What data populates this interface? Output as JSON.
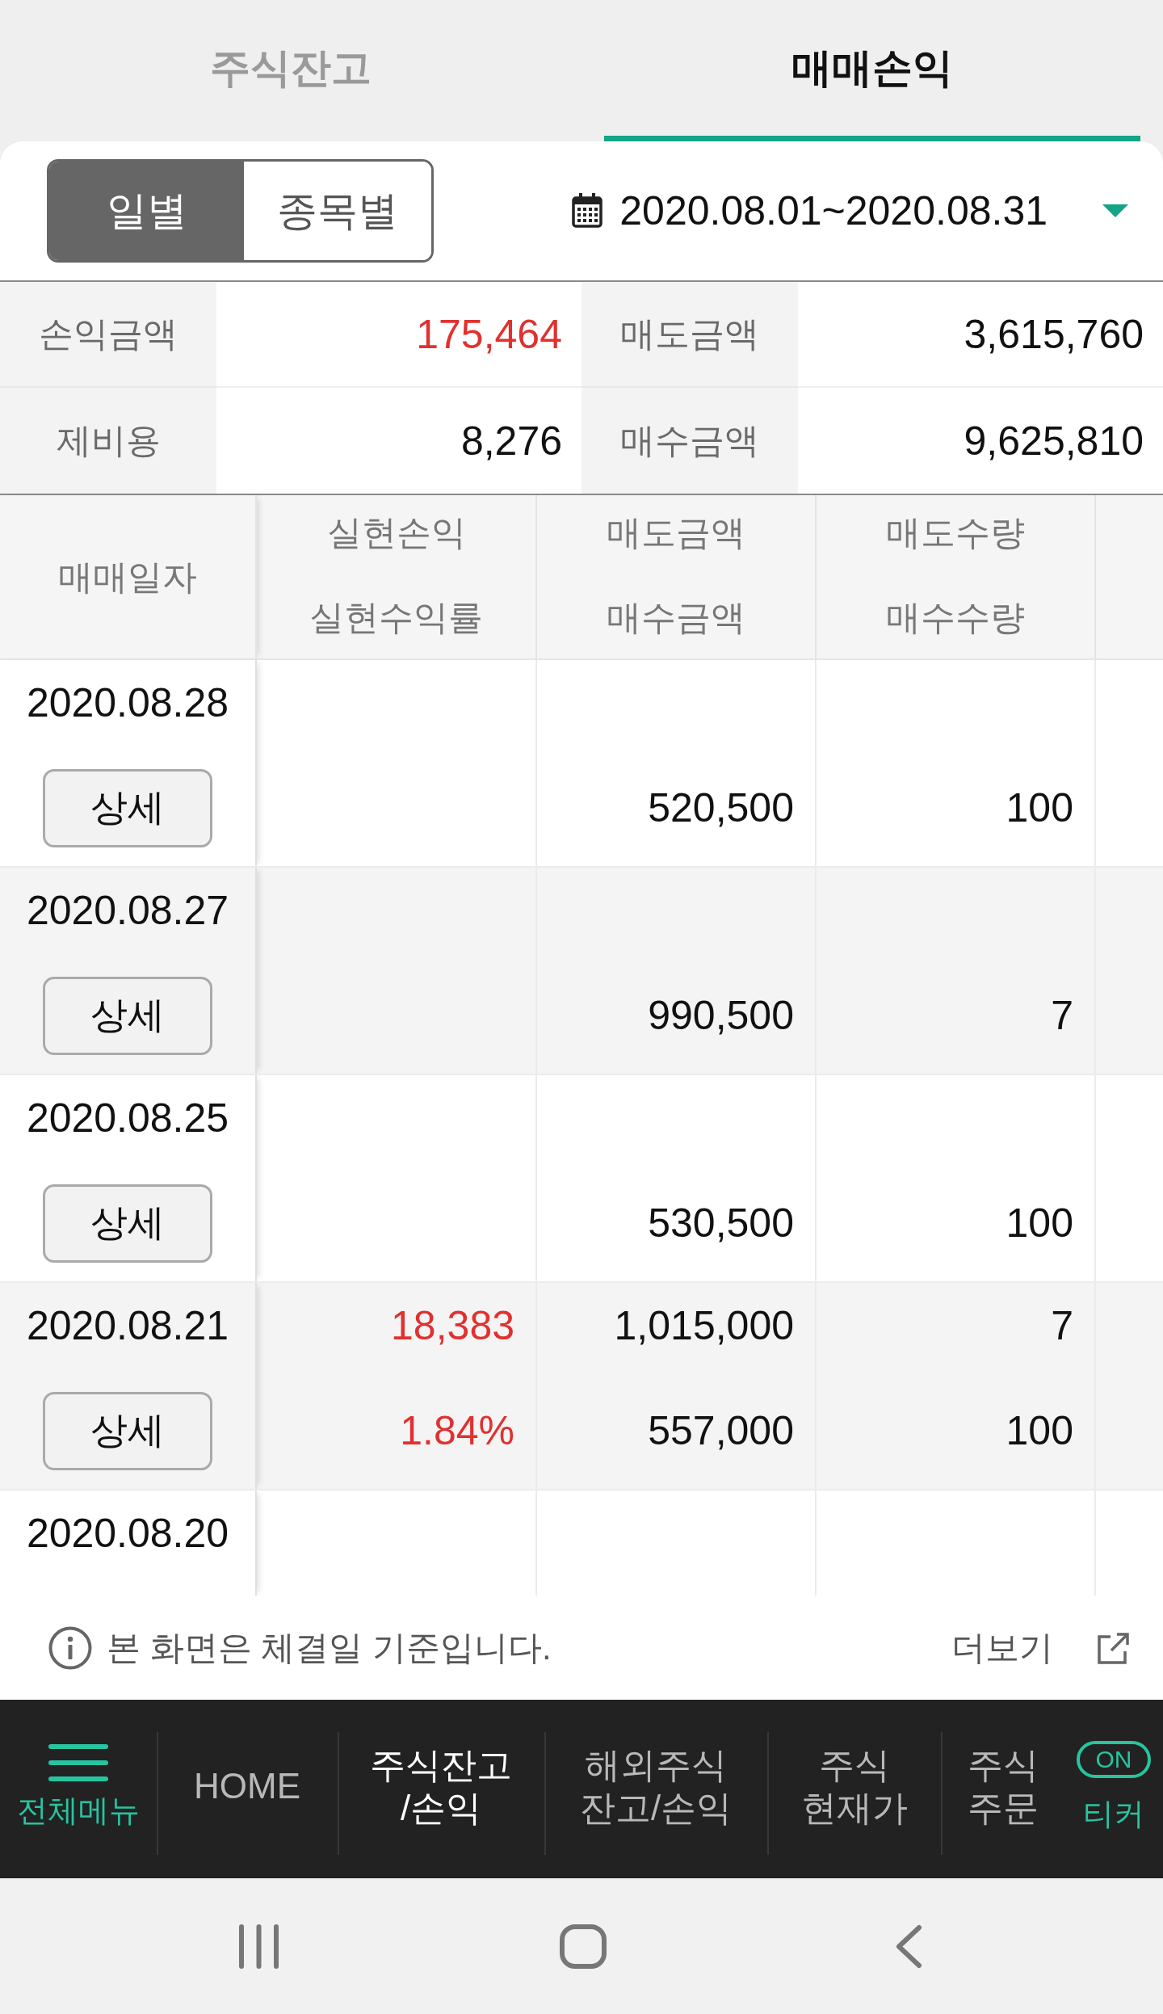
{
  "tabs": [
    {
      "label": "주식잔고",
      "selected": false
    },
    {
      "label": "매매손익",
      "selected": true
    }
  ],
  "view_toggle": [
    {
      "label": "일별",
      "selected": true
    },
    {
      "label": "종목별",
      "selected": false
    }
  ],
  "date_range": "2020.08.01~2020.08.31",
  "summary": [
    {
      "label": "손익금액",
      "value": "175,464",
      "gain": true
    },
    {
      "label": "매도금액",
      "value": "3,615,760",
      "gain": false
    },
    {
      "label": "제비용",
      "value": "8,276",
      "gain": false
    },
    {
      "label": "매수금액",
      "value": "9,625,810",
      "gain": false
    }
  ],
  "table": {
    "columns": [
      {
        "label": "매매일자"
      },
      {
        "label": "실현손익",
        "sub_label": "실현수익률"
      },
      {
        "label": "매도금액",
        "sub_label": "매수금액"
      },
      {
        "label": "매도수량",
        "sub_label": "매수수량"
      }
    ],
    "rows": [
      {
        "date": "2020.08.28",
        "detail_button": "상세",
        "buy_amount": "520,500",
        "buy_quantity": "100"
      },
      {
        "date": "2020.08.27",
        "detail_button": "상세",
        "buy_amount": "990,500",
        "buy_quantity": "7"
      },
      {
        "date": "2020.08.25",
        "detail_button": "상세",
        "buy_amount": "530,500",
        "buy_quantity": "100"
      },
      {
        "date": "2020.08.21",
        "detail_button": "상세",
        "realized_profit": "18,383",
        "realized_return": "1.84%",
        "gain": true,
        "sell_amount": "1,015,000",
        "buy_amount": "557,000",
        "sell_quantity": "7",
        "buy_quantity": "100"
      },
      {
        "date": "2020.08.20"
      }
    ]
  },
  "footer": {
    "notice": "본 화면은 체결일 기준입니다.",
    "more_link": "더보기"
  },
  "bottom_nav": [
    {
      "kind": "menu",
      "lines": [
        "전체메뉴"
      ],
      "selected": false
    },
    {
      "kind": "link",
      "lines": [
        "HOME"
      ],
      "selected": false
    },
    {
      "kind": "link",
      "lines": [
        "주식잔고",
        "/손익"
      ],
      "selected": true
    },
    {
      "kind": "link",
      "lines": [
        "해외주식",
        "잔고/손익"
      ],
      "selected": false
    },
    {
      "kind": "link",
      "lines": [
        "주식",
        "현재가"
      ],
      "selected": false
    },
    {
      "kind": "link",
      "lines": [
        "주식",
        "주문"
      ],
      "selected": false
    },
    {
      "kind": "ticker",
      "lines": [
        "티커"
      ],
      "toggle": "ON",
      "on": true,
      "selected": false
    }
  ]
}
